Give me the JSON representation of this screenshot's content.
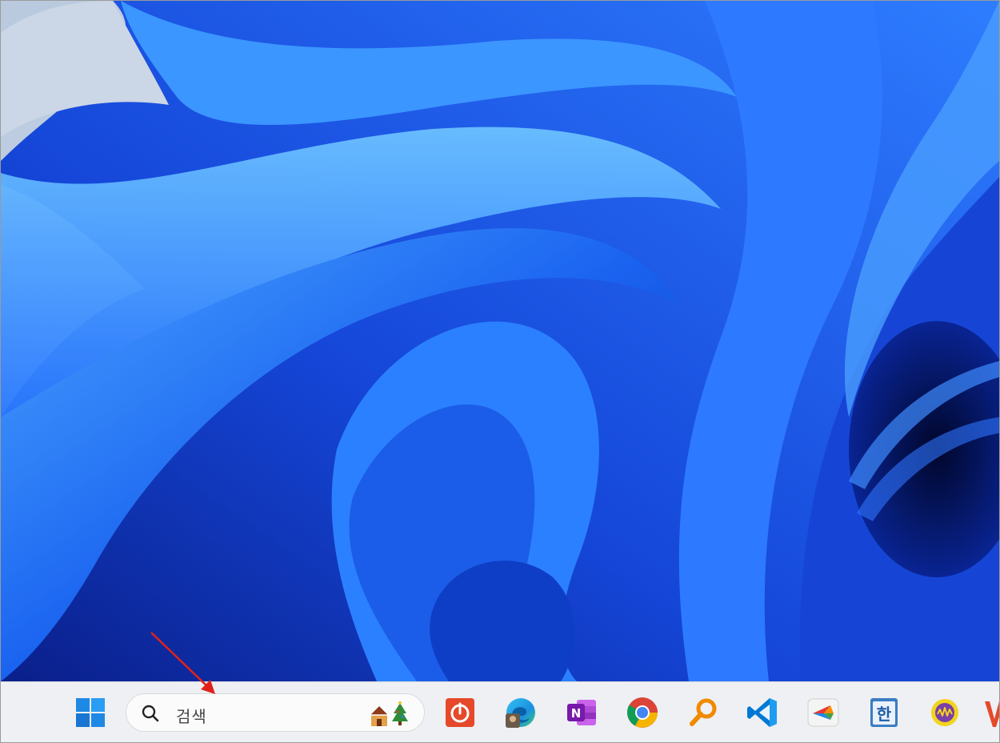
{
  "search": {
    "placeholder": "검색"
  },
  "taskbar": {
    "icons": [
      {
        "name": "windows-start-icon"
      },
      {
        "name": "power-app-icon"
      },
      {
        "name": "edge-icon"
      },
      {
        "name": "onenote-icon"
      },
      {
        "name": "chrome-icon"
      },
      {
        "name": "search-tool-icon"
      },
      {
        "name": "vscode-icon"
      },
      {
        "name": "app-icon"
      },
      {
        "name": "hangul-icon"
      },
      {
        "name": "audio-app-icon"
      }
    ],
    "hangul_label": "한"
  },
  "colors": {
    "accent": "#1f6bff",
    "arrow": "#e0211b"
  }
}
